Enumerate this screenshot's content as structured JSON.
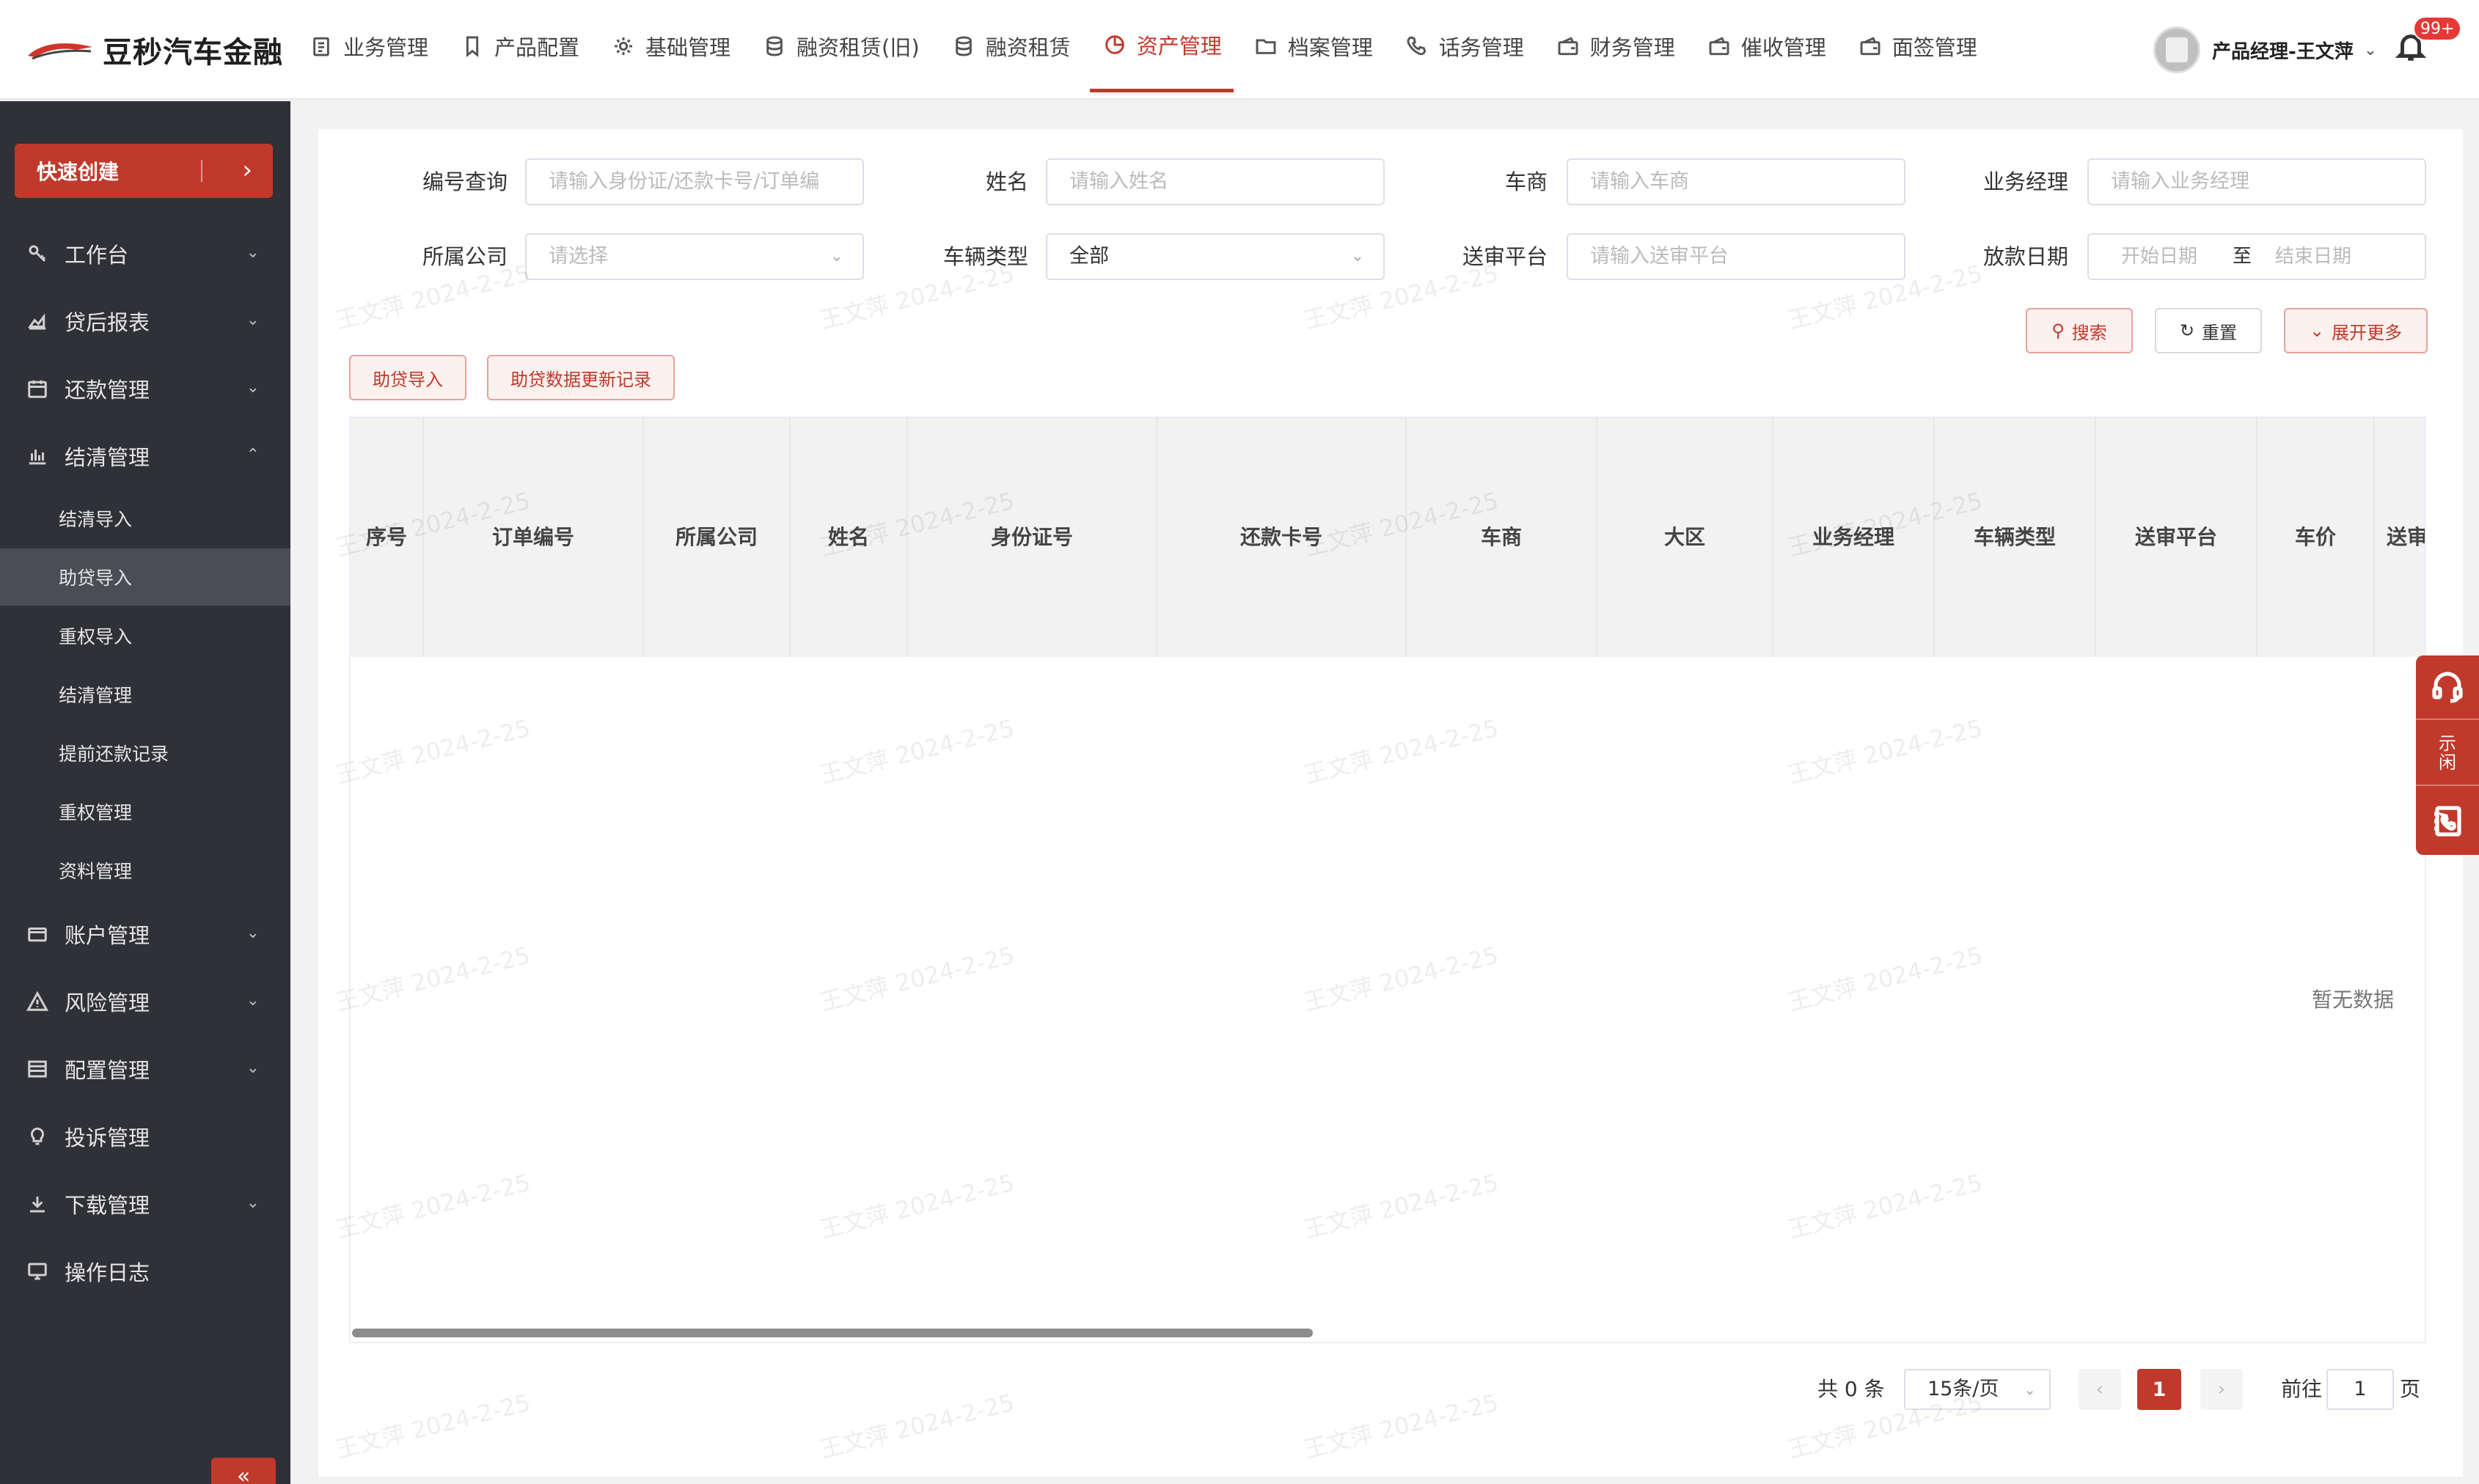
{
  "brand": {
    "name": "豆秒汽车金融"
  },
  "topnav": {
    "items": [
      {
        "label": "业务管理",
        "icon": "clipboard-icon"
      },
      {
        "label": "产品配置",
        "icon": "bookmark-icon"
      },
      {
        "label": "基础管理",
        "icon": "gear-icon"
      },
      {
        "label": "融资租赁(旧)",
        "icon": "database-icon"
      },
      {
        "label": "融资租赁",
        "icon": "database-icon"
      },
      {
        "label": "资产管理",
        "icon": "pie-chart-icon",
        "active": true
      },
      {
        "label": "档案管理",
        "icon": "folder-icon"
      },
      {
        "label": "话务管理",
        "icon": "phone-icon"
      },
      {
        "label": "财务管理",
        "icon": "wallet-icon"
      },
      {
        "label": "催收管理",
        "icon": "wallet-icon"
      },
      {
        "label": "面签管理",
        "icon": "wallet-icon"
      }
    ],
    "user": {
      "name": "产品经理-王文萍"
    },
    "notifications": {
      "badge": "99+"
    }
  },
  "sidebar": {
    "quick_create": "快速创建",
    "items": [
      {
        "label": "工作台",
        "icon": "key-icon"
      },
      {
        "label": "贷后报表",
        "icon": "area-chart-icon"
      },
      {
        "label": "还款管理",
        "icon": "calendar-icon"
      },
      {
        "label": "结清管理",
        "icon": "bar-chart-icon",
        "expanded": true
      }
    ],
    "subitems": [
      {
        "label": "结清导入"
      },
      {
        "label": "助贷导入",
        "active": true
      },
      {
        "label": "重权导入"
      },
      {
        "label": "结清管理"
      },
      {
        "label": "提前还款记录"
      },
      {
        "label": "重权管理"
      },
      {
        "label": "资料管理"
      }
    ],
    "items_after": [
      {
        "label": "账户管理",
        "icon": "card-icon"
      },
      {
        "label": "风险管理",
        "icon": "warning-icon"
      },
      {
        "label": "配置管理",
        "icon": "list-icon"
      },
      {
        "label": "投诉管理",
        "icon": "bulb-icon"
      },
      {
        "label": "下载管理",
        "icon": "download-icon"
      },
      {
        "label": "操作日志",
        "icon": "monitor-icon"
      }
    ],
    "collapse": "«"
  },
  "filters": {
    "code": {
      "label": "编号查询",
      "placeholder": "请输入身份证/还款卡号/订单编"
    },
    "name": {
      "label": "姓名",
      "placeholder": "请输入姓名"
    },
    "dealer": {
      "label": "车商",
      "placeholder": "请输入车商"
    },
    "manager": {
      "label": "业务经理",
      "placeholder": "请输入业务经理"
    },
    "company": {
      "label": "所属公司",
      "placeholder": "请选择"
    },
    "vehicle_type": {
      "label": "车辆类型",
      "value": "全部"
    },
    "platform": {
      "label": "送审平台",
      "placeholder": "请输入送审平台"
    },
    "loan_date": {
      "label": "放款日期",
      "start": "开始日期",
      "sep": "至",
      "end": "结束日期"
    }
  },
  "actions": {
    "search": "搜索",
    "reset": "重置",
    "expand": "展开更多"
  },
  "toolbar": {
    "import": "助贷导入",
    "update_log": "助贷数据更新记录"
  },
  "table": {
    "columns": [
      "序号",
      "订单编号",
      "所属公司",
      "姓名",
      "身份证号",
      "还款卡号",
      "车商",
      "大区",
      "业务经理",
      "车辆类型",
      "送审平台",
      "车价",
      "送审"
    ],
    "empty_text": "暂无数据"
  },
  "pagination": {
    "total": "共 0 条",
    "page_size": "15条/页",
    "current": "1",
    "goto_prefix": "前往",
    "goto_value": "1",
    "goto_suffix": "页"
  },
  "float_bar": {
    "idle_text": [
      "示",
      "闲"
    ]
  },
  "watermark": "王文萍 2024-2-25",
  "colors": {
    "accent": "#c0392b",
    "sidebar": "#2f3136"
  }
}
